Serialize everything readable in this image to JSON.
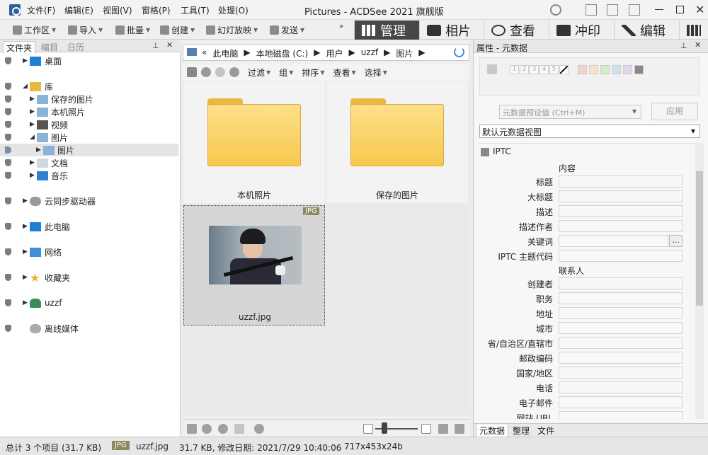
{
  "window": {
    "title": "Pictures - ACDSee 2021 旗舰版",
    "menus": [
      "文件(F)",
      "编辑(E)",
      "视图(V)",
      "窗格(P)",
      "工具(T)",
      "处理(O)"
    ]
  },
  "toolbar": {
    "items": [
      "工作区",
      "导入",
      "批量",
      "创建",
      "幻灯放映",
      "发送"
    ],
    "modes": [
      "管理",
      "相片",
      "查看",
      "冲印",
      "编辑"
    ]
  },
  "left_panel": {
    "tabs": [
      "文件夹",
      "编目",
      "日历"
    ],
    "tree": [
      {
        "label": "桌面",
        "icon": "desktop-icon"
      },
      {
        "label": "库",
        "icon": "library-icon"
      },
      {
        "label": "保存的图片",
        "icon": "pictures-folder-icon"
      },
      {
        "label": "本机照片",
        "icon": "pictures-folder-icon"
      },
      {
        "label": "视频",
        "icon": "video-icon"
      },
      {
        "label": "图片",
        "icon": "pictures-folder-icon"
      },
      {
        "label": "图片",
        "icon": "pictures-folder-icon"
      },
      {
        "label": "文档",
        "icon": "document-icon"
      },
      {
        "label": "音乐",
        "icon": "music-icon"
      },
      {
        "label": "云同步驱动器",
        "icon": "cloud-icon"
      },
      {
        "label": "此电脑",
        "icon": "computer-icon"
      },
      {
        "label": "网络",
        "icon": "network-icon"
      },
      {
        "label": "收藏夹",
        "icon": "star-icon"
      },
      {
        "label": "uzzf",
        "icon": "user-icon"
      },
      {
        "label": "离线媒体",
        "icon": "offline-media-icon"
      }
    ]
  },
  "center": {
    "breadcrumb": [
      "«",
      "此电脑",
      "本地磁盘 (C:)",
      "用户",
      "uzzf",
      "图片"
    ],
    "tools": [
      "过滤",
      "组",
      "排序",
      "查看",
      "选择"
    ],
    "items": [
      {
        "name": "本机照片",
        "type": "folder"
      },
      {
        "name": "保存的图片",
        "type": "folder"
      },
      {
        "name": "uzzf.jpg",
        "type": "image",
        "badge": "JPG"
      }
    ]
  },
  "right_panel": {
    "title": "属性 - 元数据",
    "ratings": [
      "1",
      "2",
      "3",
      "4",
      "5"
    ],
    "preset_placeholder": "元数据预设值 (Ctrl+M)",
    "apply": "应用",
    "view": "默认元数据视图",
    "section": "IPTC",
    "groups": [
      {
        "name": "内容",
        "fields": [
          "标题",
          "大标题",
          "描述",
          "描述作者",
          "关键词",
          "IPTC 主题代码"
        ]
      },
      {
        "name": "联系人",
        "fields": [
          "创建者",
          "职务",
          "地址",
          "城市",
          "省/自治区/直辖市",
          "邮政编码",
          "国家/地区",
          "电话",
          "电子邮件",
          "网站 URL"
        ]
      }
    ],
    "more": "...",
    "tabs": [
      "元数据",
      "整理",
      "文件"
    ]
  },
  "status": {
    "total": "总计 3 个项目 (31.7 KB)",
    "badge": "JPG",
    "filename": "uzzf.jpg",
    "info": "31.7 KB, 修改日期: 2021/7/29 10:40:06",
    "dims": "717x453x24b"
  }
}
